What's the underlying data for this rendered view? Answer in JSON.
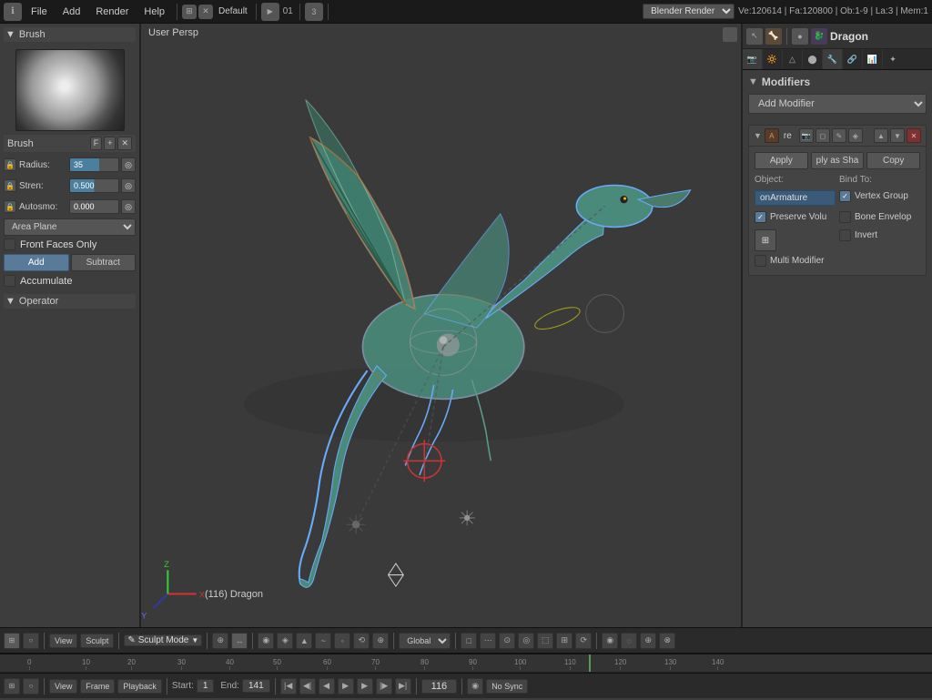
{
  "topbar": {
    "info_icon": "ℹ",
    "menus": [
      "File",
      "Add",
      "Render",
      "Help"
    ],
    "layout": "Default",
    "frame_num": "01",
    "scene_num": "3",
    "engine": "Blender Render",
    "stats": "Ve:120614 | Fa:120800 | Ob:1-9 | La:3 | Mem:1"
  },
  "left_panel": {
    "title": "Brush",
    "brush_name": "Brush",
    "brush_key": "F",
    "radius_label": "Radius:",
    "radius_value": "35",
    "strength_label": "Stren:",
    "strength_value": "0.500",
    "autosmooth_label": "Autosmo:",
    "autosmooth_value": "0.000",
    "plane_dropdown": "Area Plane",
    "front_faces_label": "Front Faces Only",
    "add_label": "Add",
    "subtract_label": "Subtract",
    "accumulate_label": "Accumulate",
    "operator_label": "Operator"
  },
  "viewport": {
    "label": "User Persp",
    "object_label": "(116) Dragon"
  },
  "right_panel": {
    "icons": [
      "arrow",
      "bone",
      "dot",
      "dragon",
      "gear"
    ],
    "object_name": "Dragon",
    "section": "Modifiers",
    "add_modifier_label": "Add Modifier",
    "modifier_name": "Armature",
    "modifier_re_label": "re",
    "apply_label": "Apply",
    "ply_as_sha_label": "ply as Sha",
    "copy_label": "Copy",
    "object_col_label": "Object:",
    "bind_to_col_label": "Bind To:",
    "on_armature_label": "onArmature",
    "vertex_group_label": "Vertex Group",
    "preserve_volu_label": "Preserve Volu",
    "bone_envelop_label": "Bone Envelop",
    "invert_label": "Invert",
    "multi_modifier_label": "Multi Modifier"
  },
  "bottom_toolbar": {
    "view_label": "View",
    "sculpt_label": "Sculpt",
    "mode_label": "Sculpt Mode",
    "global_label": "Global",
    "icons": [
      "cursor",
      "magnet",
      "brush",
      "chisel",
      "flatten",
      "fill",
      "pinch",
      "grab"
    ]
  },
  "timeline": {
    "view_label": "View",
    "frame_label": "Frame",
    "playback_label": "Playback",
    "start_label": "Start:",
    "start_value": "1",
    "end_label": "End:",
    "end_value": "141",
    "current_label": "116",
    "sync_label": "No Sync",
    "ticks": [
      {
        "pos": 0,
        "label": "0"
      },
      {
        "pos": 60,
        "label": "10"
      },
      {
        "pos": 110,
        "label": "20"
      },
      {
        "pos": 165,
        "label": "30"
      },
      {
        "pos": 220,
        "label": "40"
      },
      {
        "pos": 275,
        "label": "50"
      },
      {
        "pos": 330,
        "label": "60"
      },
      {
        "pos": 385,
        "label": "70"
      },
      {
        "pos": 440,
        "label": "80"
      },
      {
        "pos": 490,
        "label": "90"
      },
      {
        "pos": 545,
        "label": "100"
      },
      {
        "pos": 600,
        "label": "110"
      },
      {
        "pos": 620,
        "label": "116"
      },
      {
        "pos": 655,
        "label": "120"
      },
      {
        "pos": 710,
        "label": "130"
      },
      {
        "pos": 760,
        "label": "140"
      }
    ]
  }
}
